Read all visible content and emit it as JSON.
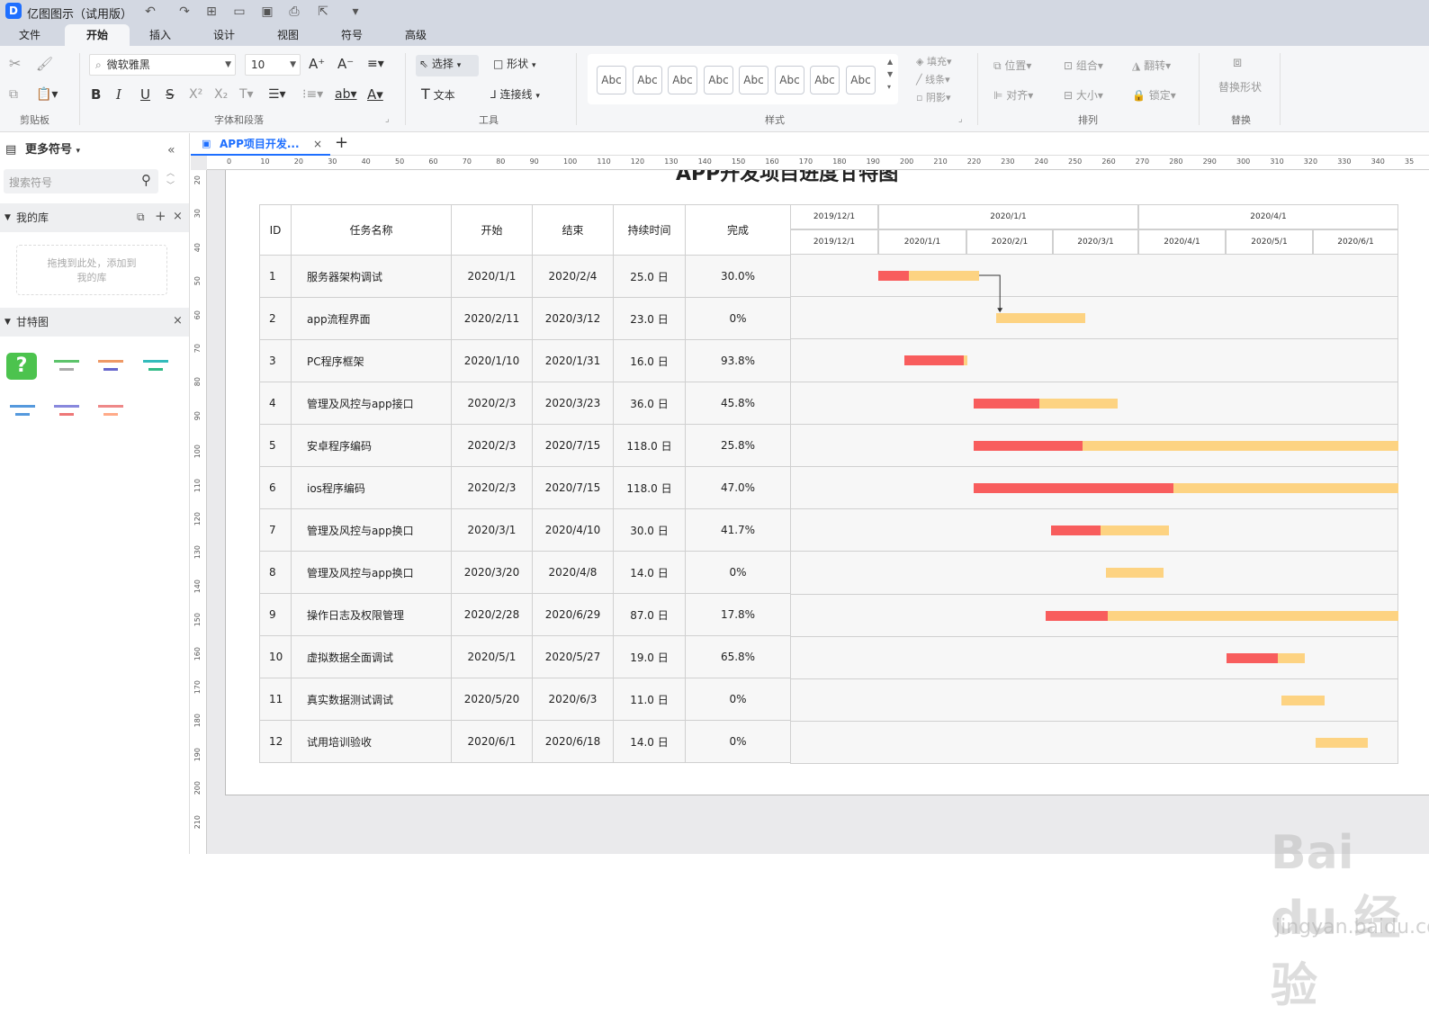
{
  "app": {
    "title": "亿图图示（试用版）",
    "logo": "D"
  },
  "menu_tabs": [
    {
      "label": "文件"
    },
    {
      "label": "开始"
    },
    {
      "label": "插入"
    },
    {
      "label": "设计"
    },
    {
      "label": "视图"
    },
    {
      "label": "符号"
    },
    {
      "label": "高级"
    }
  ],
  "ribbon": {
    "font_name": "微软雅黑",
    "font_size": "10",
    "select_label": "选择",
    "shape_label": "形状",
    "text_label": "文本",
    "connector_label": "连接线",
    "style_sample": "Abc",
    "fill_label": "填充",
    "line_label": "线条",
    "shadow_label": "阴影",
    "position_label": "位置",
    "group_label": "组合",
    "flip_label": "翻转",
    "align_label": "对齐",
    "size_label": "大小",
    "lock_label": "锁定",
    "replace_shape_label": "替换形状",
    "groups": {
      "clipboard": "剪贴板",
      "font_paragraph": "字体和段落",
      "tools": "工具",
      "style": "样式",
      "arrange": "排列",
      "replace": "替换"
    }
  },
  "left_panel": {
    "more_symbols": "更多符号",
    "search_placeholder": "搜索符号",
    "my_library": "我的库",
    "drop_hint": "拖拽到此处，添加到我的库",
    "gantt_section": "甘特图"
  },
  "doc_tab": {
    "title": "APP项目开发..."
  },
  "ruler_h": [
    "0",
    "10",
    "20",
    "30",
    "40",
    "50",
    "60",
    "70",
    "80",
    "90",
    "100",
    "110",
    "120",
    "130",
    "140",
    "150",
    "160",
    "170",
    "180",
    "190",
    "200",
    "210",
    "220",
    "230",
    "240",
    "250",
    "260",
    "270",
    "280",
    "290",
    "300",
    "310",
    "320",
    "330",
    "340",
    "35"
  ],
  "ruler_v": [
    "20",
    "30",
    "40",
    "50",
    "60",
    "70",
    "80",
    "90",
    "100",
    "110",
    "120",
    "130",
    "140",
    "150",
    "160",
    "170",
    "180",
    "190",
    "200",
    "210"
  ],
  "gantt": {
    "title": "APP开发项目进度甘特图",
    "headers": [
      "ID",
      "任务名称",
      "开始",
      "结束",
      "持续时间",
      "完成"
    ],
    "timeline_top": [
      "2019/12/1",
      "2020/1/1",
      "2020/4/1"
    ],
    "timeline_months": [
      "2019/12/1",
      "2020/1/1",
      "2020/2/1",
      "2020/3/1",
      "2020/4/1",
      "2020/5/1",
      "2020/6/1"
    ],
    "rows": [
      {
        "id": "1",
        "name": "服务器架构调试",
        "start": "2020/1/1",
        "end": "2020/2/4",
        "duration": "25.0 日",
        "complete": "30.0%",
        "pct": 0.3,
        "s": 0,
        "d": 35
      },
      {
        "id": "2",
        "name": "app流程界面",
        "start": "2020/2/11",
        "end": "2020/3/12",
        "duration": "23.0 日",
        "complete": "0%",
        "pct": 0,
        "s": 41,
        "d": 31
      },
      {
        "id": "3",
        "name": "PC程序框架",
        "start": "2020/1/10",
        "end": "2020/1/31",
        "duration": "16.0 日",
        "complete": "93.8%",
        "pct": 0.938,
        "s": 9,
        "d": 22
      },
      {
        "id": "4",
        "name": "管理及风控与app接口",
        "start": "2020/2/3",
        "end": "2020/3/23",
        "duration": "36.0 日",
        "complete": "45.8%",
        "pct": 0.458,
        "s": 33,
        "d": 50
      },
      {
        "id": "5",
        "name": "安卓程序编码",
        "start": "2020/2/3",
        "end": "2020/7/15",
        "duration": "118.0 日",
        "complete": "25.8%",
        "pct": 0.258,
        "s": 33,
        "d": 164
      },
      {
        "id": "6",
        "name": "ios程序编码",
        "start": "2020/2/3",
        "end": "2020/7/15",
        "duration": "118.0 日",
        "complete": "47.0%",
        "pct": 0.47,
        "s": 33,
        "d": 164
      },
      {
        "id": "7",
        "name": "管理及风控与app换口",
        "start": "2020/3/1",
        "end": "2020/4/10",
        "duration": "30.0 日",
        "complete": "41.7%",
        "pct": 0.417,
        "s": 60,
        "d": 41
      },
      {
        "id": "8",
        "name": "管理及风控与app换口",
        "start": "2020/3/20",
        "end": "2020/4/8",
        "duration": "14.0 日",
        "complete": "0%",
        "pct": 0,
        "s": 79,
        "d": 20
      },
      {
        "id": "9",
        "name": "操作日志及权限管理",
        "start": "2020/2/28",
        "end": "2020/6/29",
        "duration": "87.0 日",
        "complete": "17.8%",
        "pct": 0.178,
        "s": 58,
        "d": 123
      },
      {
        "id": "10",
        "name": "虚拟数据全面调试",
        "start": "2020/5/1",
        "end": "2020/5/27",
        "duration": "19.0 日",
        "complete": "65.8%",
        "pct": 0.658,
        "s": 121,
        "d": 27
      },
      {
        "id": "11",
        "name": "真实数据测试调试",
        "start": "2020/5/20",
        "end": "2020/6/3",
        "duration": "11.0 日",
        "complete": "0%",
        "pct": 0,
        "s": 140,
        "d": 15
      },
      {
        "id": "12",
        "name": "试用培训验收",
        "start": "2020/6/1",
        "end": "2020/6/18",
        "duration": "14.0 日",
        "complete": "0%",
        "pct": 0,
        "s": 152,
        "d": 18
      }
    ]
  },
  "colors": {
    "done": "#f85d5d",
    "remaining": "#fdd382",
    "accent": "#1e6fff"
  },
  "watermark": {
    "main": "Bai du 经验",
    "sub": "jingyan.baidu.com"
  }
}
